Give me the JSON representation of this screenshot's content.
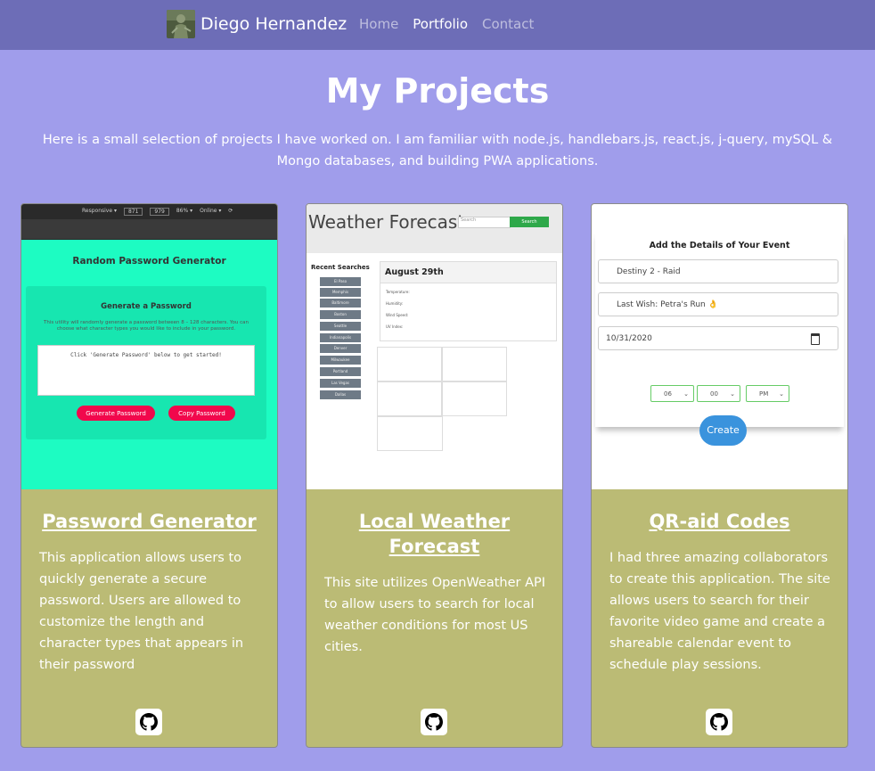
{
  "navbar": {
    "brand_name": "Diego Hernandez",
    "links": [
      "Home",
      "Portfolio",
      "Contact"
    ],
    "active_link": "Portfolio",
    "bg_color": "#6d6db7"
  },
  "header": {
    "title": "My Projects",
    "intro": "Here is a small selection of projects I have worked on. I am familiar with node.js, handlebars.js, react.js, j-query, mySQL & Mongo databases, and building PWA applications."
  },
  "colors": {
    "page_bg": "#a09deb",
    "card_bg": "#bbbb75",
    "text": "#ffffff"
  },
  "projects": [
    {
      "title": "Password Generator",
      "description": "This application allows users to quickly generate a secure password. Users are allowed to customize the length and character types that appears in their password",
      "link_icon": "github-icon",
      "thumbnail": {
        "devtools": [
          "Responsive ▾",
          "871",
          "979",
          "86% ▾",
          "Online ▾",
          "⟳"
        ],
        "heading": "Random Password Generator",
        "panel_title": "Generate a Password",
        "panel_desc": "This utility will randomly generate a password between 8 – 128 characters. You can choose what character types you would like to include in your password.",
        "placeholder": "Click 'Generate Password' below to get started!",
        "button_generate": "Generate Password",
        "button_copy": "Copy Password"
      }
    },
    {
      "title": "Local Weather Forecast",
      "description": "This site utilizes OpenWeather API to allow users to search for local weather conditions for most US cities.",
      "link_icon": "github-icon",
      "thumbnail": {
        "heading": "Weather Forecast",
        "search_placeholder": "Search",
        "search_button": "Search",
        "recent_label": "Recent Searches",
        "cities": [
          "El Paso",
          "Memphis",
          "Baltimore",
          "Boston",
          "Seattle",
          "Indianapolis",
          "Denver",
          "Milwaukee",
          "Portland",
          "Las Vegas",
          "Dallas"
        ],
        "date": "August 29th",
        "details": [
          "Temperature:",
          "Humidity:",
          "Wind Speed:",
          "UV Index:"
        ]
      }
    },
    {
      "title": "QR-aid Codes",
      "description": "I had three amazing collaborators to create this application. The site allows users to search for their favorite video game and create a shareable calendar event to schedule play sessions.",
      "link_icon": "github-icon",
      "thumbnail": {
        "heading": "Add the Details of Your Event",
        "game": "Destiny 2 - Raid",
        "event_name": "Last Wish: Petra's Run 👌",
        "date": "10/31/2020",
        "hour": "06",
        "minute": "00",
        "ampm": "PM",
        "create_button": "Create"
      }
    }
  ]
}
